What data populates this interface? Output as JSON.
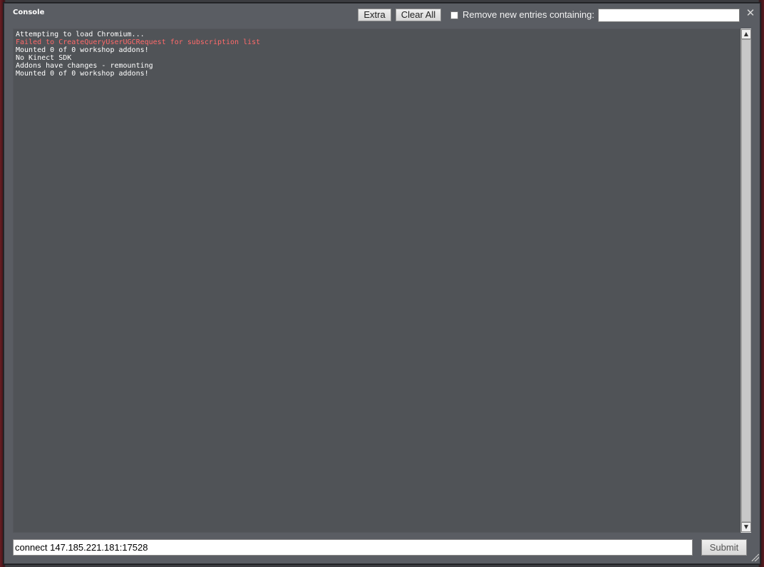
{
  "window": {
    "title": "Console",
    "close_glyph": "✕"
  },
  "toolbar": {
    "extra_label": "Extra",
    "clear_all_label": "Clear All",
    "filter_label": "Remove new entries containing:",
    "filter_value": "",
    "filter_checked": false
  },
  "log": {
    "lines": [
      {
        "text": "Attempting to load Chromium...",
        "color": "#ffffff"
      },
      {
        "text": "Failed to CreateQueryUserUGCRequest for subscription list",
        "color": "#ff6a6a"
      },
      {
        "text": "Mounted 0 of 0 workshop addons!",
        "color": "#ffffff"
      },
      {
        "text": "No Kinect SDK",
        "color": "#ffffff"
      },
      {
        "text": "Addons have changes - remounting",
        "color": "#ffffff"
      },
      {
        "text": "Mounted 0 of 0 workshop addons!",
        "color": "#ffffff"
      }
    ]
  },
  "command": {
    "value": "connect 147.185.221.181:17528",
    "submit_label": "Submit"
  },
  "icons": {
    "close": "close-icon",
    "scroll_up": "arrow-up-icon",
    "scroll_down": "arrow-down-icon",
    "resize": "resize-grip-icon"
  }
}
